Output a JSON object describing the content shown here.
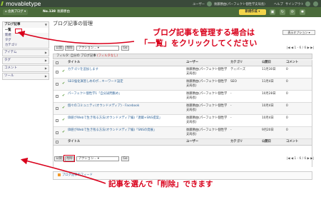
{
  "app": {
    "logo": "movabletype"
  },
  "header": {
    "user_label": "ユーザー",
    "user_name": "後藤勝由(パーフェクト個性学支局長)",
    "help_label": "ヘルプ",
    "signout_label": "サインアウト",
    "blog_selector": "会員ブログ",
    "blog_number": "No.138",
    "blog_owner": "後藤勝由",
    "new_button": "新規作成"
  },
  "sidebar": {
    "sections": [
      {
        "label": "ブログ記事",
        "items": [
          "一覧",
          "新規",
          "タグ",
          "カテゴリ"
        ],
        "active_index": 0
      },
      {
        "label": "アイテム",
        "items": []
      },
      {
        "label": "タグ",
        "items": []
      },
      {
        "label": "コメント",
        "items": []
      },
      {
        "label": "ツール",
        "items": []
      }
    ]
  },
  "main": {
    "title": "ブログ記事の管理",
    "view_options": "表示オプション",
    "toolbar": {
      "publish_label": "公開",
      "delete_label": "削除",
      "action_placeholder": "アクション...",
      "go_label": "Go",
      "pager": "|◀ ◀  1 - 6 / 6  ▶ ▶|"
    },
    "filter": {
      "prefix": "フィルタ: ",
      "value": "自分の ブログ記事",
      "change_link": "(フィルタなし)"
    },
    "columns": [
      "タイトル",
      "ユーザー",
      "カテゴリ",
      "公開日",
      "コメント"
    ],
    "rows": [
      {
        "title": "カテゴリを追加します",
        "author": "後藤勝由(パーフェクト個性学支局長)",
        "category": "ティパーズ",
        "date": "11月30日",
        "comments": "0"
      },
      {
        "title": "SEO強化演習しめのポ…キーワード設定",
        "author": "後藤勝由(パーフェクト個性学支局長)",
        "category": "SEO",
        "date": "11月4日",
        "comments": "0"
      },
      {
        "title": "パーフェクト個性学1「自分試問集め」",
        "author": "後藤勝由(パーフェクト個性学支局長)",
        "category": "-",
        "date": "10月28日",
        "comments": "0"
      },
      {
        "title": "個々のコミュニティ(オウンドメディア) - Facebook",
        "author": "後藤勝由(パーフェクト個性学支局長)",
        "category": "-",
        "date": "10月4日",
        "comments": "0"
      },
      {
        "title": "価値がWebで生き残る方法(オウンドメディア編)「連載+SNS提案」",
        "author": "後藤勝由(パーフェクト個性学支局長)",
        "category": "-",
        "date": "10月4日",
        "comments": "0"
      },
      {
        "title": "価値がWebで生き残る方法(オウンドメディア編)「SNSの発展」",
        "author": "後藤勝由(パーフェクト個性学支局長)",
        "category": "-",
        "date": "9月20日",
        "comments": "0"
      }
    ],
    "feed_link": "ブログ記事のフィード"
  },
  "annotations": {
    "top_line1": "ブログ記事を管理する場合は",
    "top_line2": "「一覧」をクリックしてください",
    "bottom_prefix": "記事を選んで「",
    "bottom_emph": "削除",
    "bottom_suffix": "」できます",
    "color": "#d9001b"
  }
}
